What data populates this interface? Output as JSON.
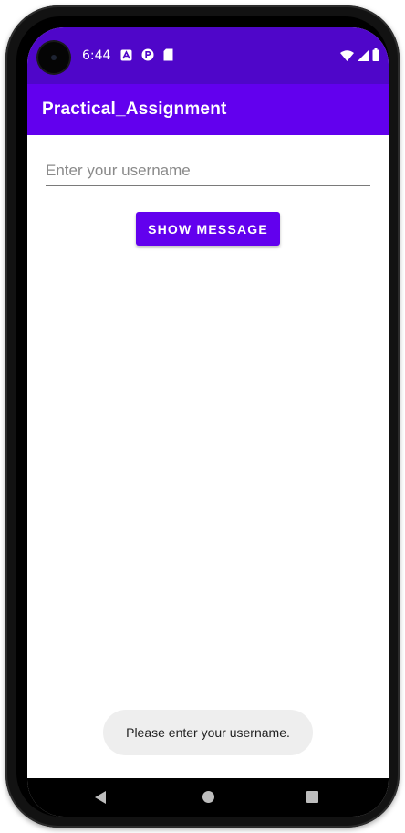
{
  "status_bar": {
    "time": "6:44",
    "left_icons": [
      "a-notification-icon",
      "p-notification-icon",
      "sd-card-icon"
    ],
    "right_icons": [
      "wifi-icon",
      "cellular-signal-icon",
      "battery-icon"
    ],
    "background_color": "#4f06c9"
  },
  "app_bar": {
    "title": "Practical_Assignment",
    "background_color": "#6200ee"
  },
  "form": {
    "username_placeholder": "Enter your username",
    "username_value": "",
    "button_label": "SHOW MESSAGE"
  },
  "toast": {
    "message": "Please enter your username."
  },
  "nav_bar": {
    "buttons": [
      "back-icon",
      "home-icon",
      "recents-icon"
    ]
  }
}
